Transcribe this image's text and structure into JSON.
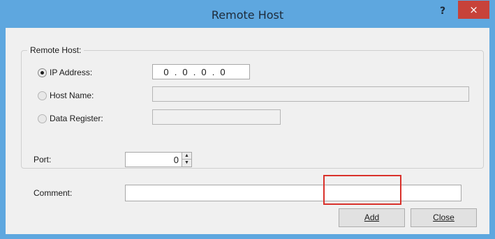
{
  "window": {
    "title": "Remote Host",
    "help_glyph": "?",
    "close_glyph": "×"
  },
  "remote_host_group": {
    "legend": "Remote Host:",
    "options": [
      {
        "label": "IP Address:",
        "selected": true,
        "enabled": true
      },
      {
        "label": "Host Name:",
        "selected": false,
        "enabled": false
      },
      {
        "label": "Data Register:",
        "selected": false,
        "enabled": false
      }
    ],
    "ip_octets": [
      "0",
      "0",
      "0",
      "0"
    ],
    "ip_separator": ".",
    "host_name_value": "",
    "data_register_value": ""
  },
  "port": {
    "label": "Port:",
    "value": "0"
  },
  "comment": {
    "label": "Comment:",
    "value": ""
  },
  "buttons": {
    "add_label": "Add",
    "close_label": "Close"
  },
  "colors": {
    "titlebar": "#5ea7df",
    "close_button": "#c7423a",
    "highlight": "#d9312b"
  }
}
